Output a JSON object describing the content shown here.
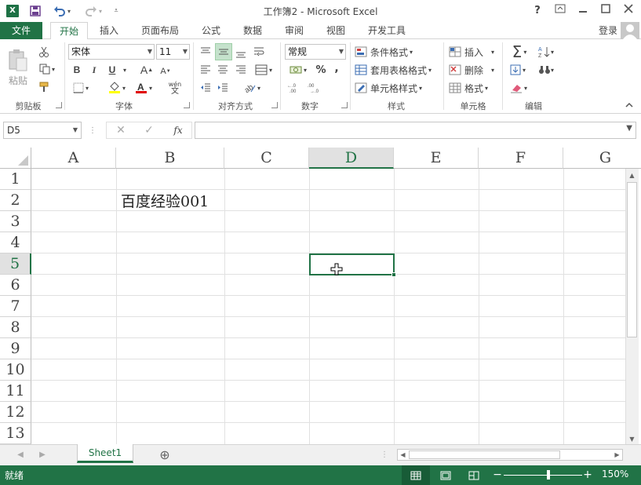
{
  "window": {
    "title": "工作簿2 - Microsoft Excel",
    "help": "?",
    "restore_ribbon": "⧉",
    "minimize": "—",
    "maximize": "☐",
    "close": "✕"
  },
  "qat": {
    "save": "💾",
    "undo": "↶",
    "redo": "↷",
    "customize": "⯆"
  },
  "tabs": {
    "file": "文件",
    "home": "开始",
    "insert": "插入",
    "layout": "页面布局",
    "formulas": "公式",
    "data": "数据",
    "review": "审阅",
    "view": "视图",
    "developer": "开发工具"
  },
  "account": {
    "login": "登录"
  },
  "ribbon": {
    "clipboard": {
      "paste": "粘贴",
      "label": "剪贴板"
    },
    "font": {
      "name": "宋体",
      "size": "11",
      "bold": "B",
      "italic": "I",
      "underline": "U",
      "grow": "A",
      "shrink": "A",
      "wen": "wén",
      "wen2": "文",
      "label": "字体"
    },
    "align": {
      "label": "对齐方式"
    },
    "number": {
      "format": "常规",
      "percent": "%",
      "comma": ",",
      "label": "数字"
    },
    "styles": {
      "conditional": "条件格式",
      "table": "套用表格格式",
      "cell": "单元格样式",
      "label": "样式"
    },
    "cells": {
      "insert": "插入",
      "delete": "删除",
      "format": "格式",
      "label": "单元格"
    },
    "editing": {
      "sum": "Σ",
      "label": "编辑"
    }
  },
  "formula_bar": {
    "name_box": "D5",
    "cancel": "✕",
    "enter": "✓",
    "fx": "fx",
    "value": ""
  },
  "grid": {
    "columns": [
      "A",
      "B",
      "C",
      "D",
      "E",
      "F",
      "G"
    ],
    "rows": [
      "1",
      "2",
      "3",
      "4",
      "5",
      "6",
      "7",
      "8",
      "9",
      "10",
      "11",
      "12",
      "13"
    ],
    "b2": "百度经验001",
    "active_cell": "D5"
  },
  "sheets": {
    "active": "Sheet1",
    "add": "⊕"
  },
  "status": {
    "ready": "就绪",
    "zoom": "150%",
    "minus": "−",
    "plus": "+"
  },
  "colors": {
    "accent": "#217346",
    "active_header": "#217346"
  }
}
